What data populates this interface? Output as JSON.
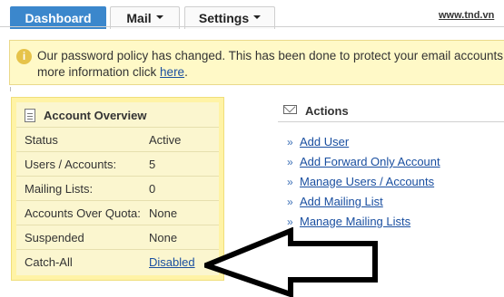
{
  "nav": {
    "tabs": [
      {
        "label": "Dashboard",
        "active": true
      },
      {
        "label": "Mail",
        "has_dropdown": true
      },
      {
        "label": "Settings",
        "has_dropdown": true
      }
    ],
    "site_link": "www.tnd.vn"
  },
  "notice": {
    "icon": "info-icon",
    "line1": "Our password policy has changed. This has been done to protect your email accounts fro",
    "line2_prefix": "more information click ",
    "line2_link": "here",
    "line2_suffix": "."
  },
  "overview": {
    "title": "Account Overview",
    "icon": "document-icon",
    "rows": [
      {
        "label": "Status",
        "value": "Active"
      },
      {
        "label": "Users / Accounts:",
        "value": "5"
      },
      {
        "label": "Mailing Lists:",
        "value": "0"
      },
      {
        "label": "Accounts Over Quota:",
        "value": "None"
      },
      {
        "label": "Suspended",
        "value": "None"
      },
      {
        "label": "Catch-All",
        "value": "Disabled",
        "link": true
      }
    ]
  },
  "actions": {
    "title": "Actions",
    "icon": "envelope-icon",
    "bullet": "»",
    "items": [
      "Add User",
      "Add Forward Only Account",
      "Manage Users / Accounts",
      "Add Mailing List",
      "Manage Mailing Lists"
    ]
  },
  "colors": {
    "active_tab": "#3b87cc",
    "notice_bg": "#fff9c7",
    "panel_bg": "#fbf6cf",
    "link": "#1a4fa0"
  }
}
